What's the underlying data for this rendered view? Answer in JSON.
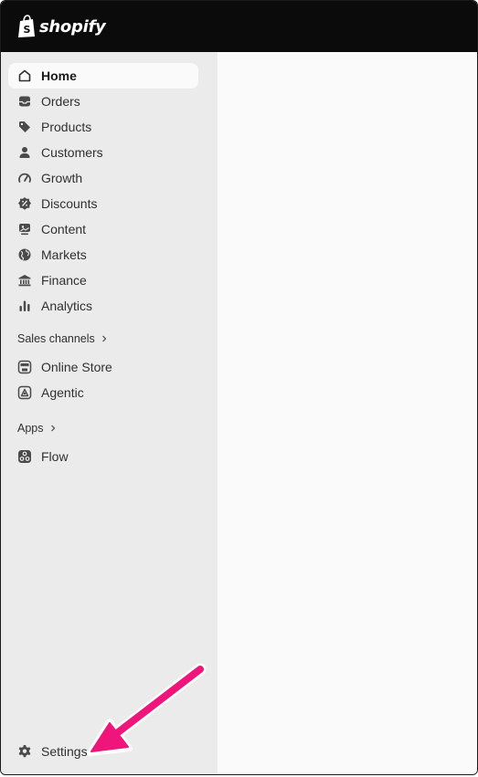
{
  "brand": {
    "name": "shopify"
  },
  "nav": {
    "items": [
      {
        "label": "Home",
        "icon": "home-icon",
        "active": true
      },
      {
        "label": "Orders",
        "icon": "inbox-icon"
      },
      {
        "label": "Products",
        "icon": "tag-icon"
      },
      {
        "label": "Customers",
        "icon": "person-icon"
      },
      {
        "label": "Growth",
        "icon": "gauge-icon"
      },
      {
        "label": "Discounts",
        "icon": "discount-badge-icon"
      },
      {
        "label": "Content",
        "icon": "image-frame-icon"
      },
      {
        "label": "Markets",
        "icon": "globe-icon"
      },
      {
        "label": "Finance",
        "icon": "bank-icon"
      },
      {
        "label": "Analytics",
        "icon": "bar-chart-icon"
      }
    ]
  },
  "sales_channels": {
    "title": "Sales channels",
    "items": [
      {
        "label": "Online Store",
        "icon": "storefront-icon"
      },
      {
        "label": "Agentic",
        "icon": "agentic-icon"
      }
    ]
  },
  "apps": {
    "title": "Apps",
    "items": [
      {
        "label": "Flow",
        "icon": "flow-icon"
      }
    ]
  },
  "settings": {
    "label": "Settings",
    "icon": "gear-icon"
  },
  "annotation": {
    "arrow_color": "#f0157a"
  },
  "colors": {
    "topbar": "#0b0b0b",
    "sidebar": "#ebebeb",
    "main": "#fafafa",
    "text": "#303030"
  }
}
